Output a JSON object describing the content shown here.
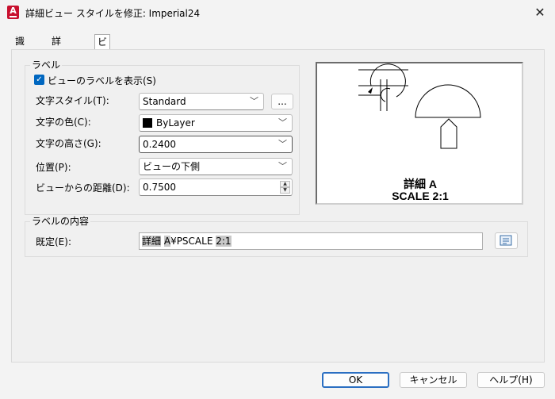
{
  "window": {
    "title": "詳細ビュー スタイルを修正: Imperial24",
    "app_icon_letter": "A",
    "close_glyph": "✕"
  },
  "tabs": [
    {
      "label": "識別子"
    },
    {
      "label": "詳細境界"
    },
    {
      "label": "ビュー ラベル"
    }
  ],
  "label_group": {
    "title": "ラベル",
    "show_label_checkbox": {
      "label": "ビューのラベルを表示(S)",
      "checked": true
    },
    "text_style": {
      "label": "文字スタイル(T):",
      "value": "Standard",
      "browse_label": "..."
    },
    "text_color": {
      "label": "文字の色(C):",
      "value": "ByLayer",
      "swatch_color": "#000000"
    },
    "text_height": {
      "label": "文字の高さ(G):",
      "value": "0.2400"
    },
    "position": {
      "label": "位置(P):",
      "value": "ビューの下側"
    },
    "offset": {
      "label": "ビューからの距離(D):",
      "value": "0.7500"
    }
  },
  "preview": {
    "line1": "詳細 A",
    "line2": "SCALE 2:1"
  },
  "contents_group": {
    "title": "ラベルの内容",
    "default_label": "既定(E):",
    "value_parts": [
      "詳細",
      " ",
      "A",
      "¥PSCALE ",
      "2:1"
    ]
  },
  "footer": {
    "ok": "OK",
    "cancel": "キャンセル",
    "help": "ヘルプ(H)"
  },
  "colors": {
    "accent": "#0067c0",
    "ok_border": "#2b6fc2",
    "app_icon": "#c8102e"
  }
}
